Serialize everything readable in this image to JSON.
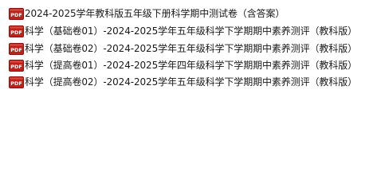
{
  "colors": {
    "background": "#ffffff",
    "text": "#1a1a1a",
    "pdf_icon_red": "#c0201a",
    "pdf_icon_text": "#ffffff"
  },
  "files": [
    {
      "icon": "pdf-icon",
      "icon_label": "PDF",
      "name": "2024-2025学年教科版五年级下册科学期中测试卷（含答案）"
    },
    {
      "icon": "pdf-icon",
      "icon_label": "PDF",
      "name": "科学（基础卷01）-2024-2025学年五年级科学下学期期中素养测评（教科版）"
    },
    {
      "icon": "pdf-icon",
      "icon_label": "PDF",
      "name": "科学（基础卷02）-2024-2025学年五年级科学下学期期中素养测评（教科版）"
    },
    {
      "icon": "pdf-icon",
      "icon_label": "PDF",
      "name": "科学（提高卷01）-2024-2025学年四年级科学下学期期中素养测评（教科版）"
    },
    {
      "icon": "pdf-icon",
      "icon_label": "PDF",
      "name": "科学（提高卷02）-2024-2025学年五年级科学下学期期中素养测评（教科版）"
    }
  ]
}
